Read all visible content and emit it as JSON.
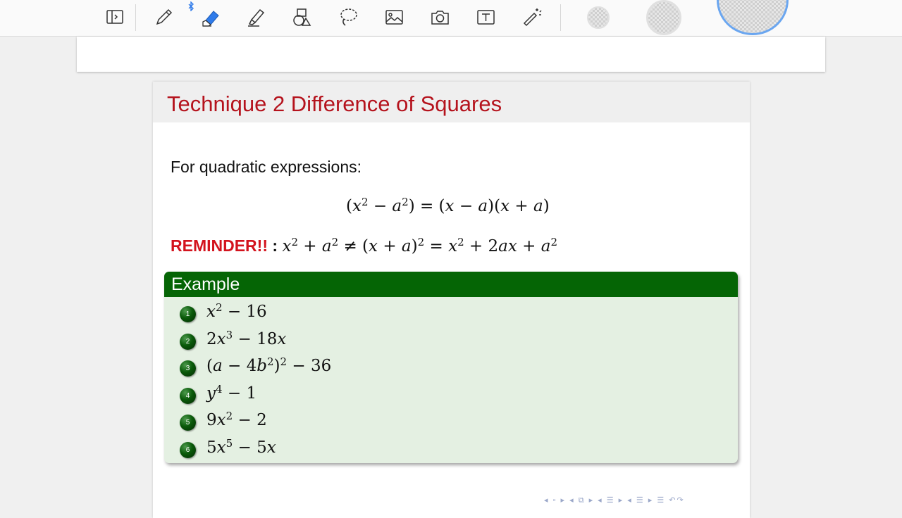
{
  "toolbar": {
    "tools": [
      "sidebar-toggle-icon",
      "pen-icon",
      "eraser-icon",
      "highlighter-icon",
      "shapes-icon",
      "lasso-icon",
      "image-icon",
      "camera-icon",
      "text-box-icon",
      "magic-wand-icon"
    ],
    "accent_color": "#2f7bea",
    "selected_swatch_border": "#6aa6f0"
  },
  "slide": {
    "title": "Technique 2 Difference of Squares",
    "title_color": "#b5131d",
    "intro": "For quadratic expressions:",
    "equation": {
      "p1": "(",
      "x1": "x",
      "e1": "2",
      "m1": " − ",
      "a1": "a",
      "e2": "2",
      "p2": ") = (",
      "x2": "x",
      "m2": " − ",
      "a2": "a",
      "p3": ")(",
      "x3": "x",
      "m3": " + ",
      "a3": "a",
      "p4": ")"
    },
    "reminder": {
      "label": "REMINDER!!",
      "colon": " : ",
      "t1": "x",
      "e1": "2",
      "t2": " + ",
      "t3": "a",
      "e2": "2",
      "t4": " ≠ (",
      "t5": "x",
      "t6": " + ",
      "t7": "a",
      "t8": ")",
      "e3": "2",
      "t9": " = ",
      "t10": "x",
      "e4": "2",
      "t11": " + 2",
      "t12": "ax",
      "t13": " + ",
      "t14": "a",
      "e5": "2"
    },
    "example": {
      "title": "Example",
      "header_color": "#056505",
      "items": [
        {
          "num": "1",
          "parts": [
            "x",
            "2",
            " − 16"
          ]
        },
        {
          "num": "2",
          "parts": [
            "2",
            "x",
            "3",
            " − 18",
            "x"
          ]
        },
        {
          "num": "3",
          "parts": [
            "(",
            "a",
            " − 4",
            "b",
            "2",
            ")",
            "2",
            " − 36"
          ]
        },
        {
          "num": "4",
          "parts": [
            "y",
            "4",
            " − 1"
          ]
        },
        {
          "num": "5",
          "parts": [
            "9",
            "x",
            "2",
            " − 2"
          ]
        },
        {
          "num": "6",
          "parts": [
            "5",
            "x",
            "5",
            " − 5",
            "x"
          ]
        }
      ]
    },
    "nav": "◂ ▫ ▸ ◂ ⧉ ▸ ◂ ☰ ▸ ◂ ☰ ▸ ☰ ↶↷"
  }
}
